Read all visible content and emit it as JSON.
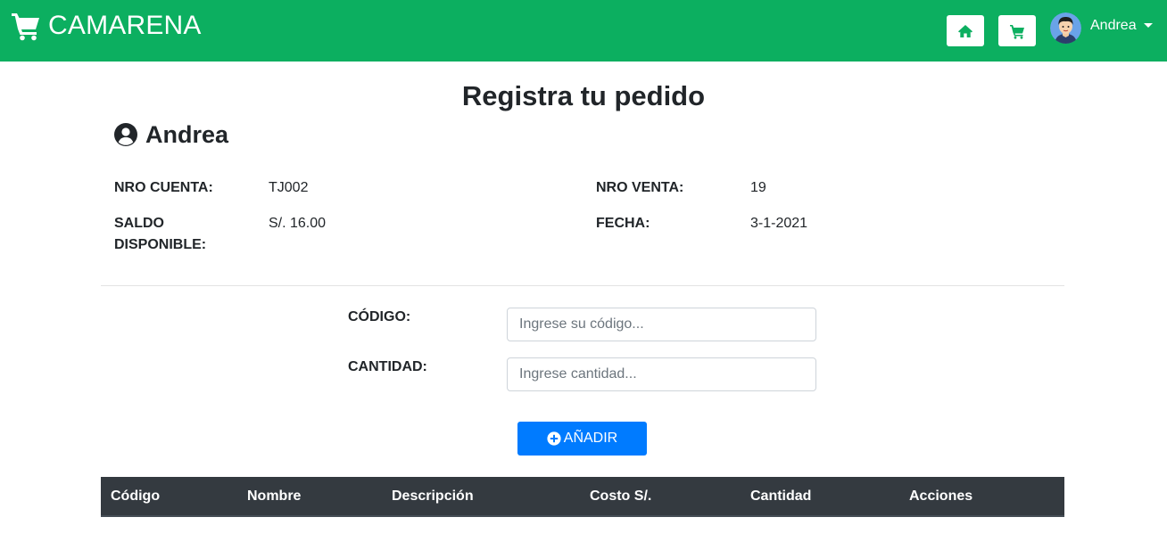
{
  "navbar": {
    "brand": "CAMARENA",
    "brand_icon": "shopping-cart-icon",
    "home_icon": "home-icon",
    "cart_icon": "shopping-cart-icon",
    "user_name": "Andrea",
    "color": "#0caf60"
  },
  "page": {
    "title": "Registra tu pedido",
    "user_heading": "Andrea"
  },
  "info": {
    "account_label": "NRO CUENTA:",
    "account_value": "TJ002",
    "balance_label_line1": "SALDO",
    "balance_label_line2": "DISPONIBLE:",
    "balance_value": "S/. 16.00",
    "sale_label": "NRO VENTA:",
    "sale_value": "19",
    "date_label": "FECHA:",
    "date_value": "3-1-2021"
  },
  "form": {
    "code_label": "CÓDIGO:",
    "code_placeholder": "Ingrese su código...",
    "qty_label": "CANTIDAD:",
    "qty_placeholder": "Ingrese cantidad...",
    "add_label": "AÑADIR",
    "add_color": "#007bff"
  },
  "table": {
    "columns": [
      "Código",
      "Nombre",
      "Descripción",
      "Costo S/.",
      "Cantidad",
      "Acciones"
    ],
    "header_color": "#343a40"
  }
}
